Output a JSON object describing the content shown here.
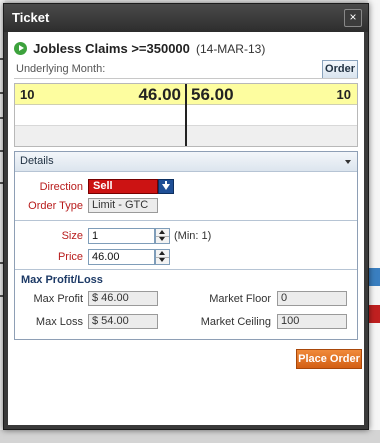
{
  "window": {
    "title": "Ticket",
    "close_glyph": "×"
  },
  "market": {
    "name": "Jobless Claims >=350000",
    "date": "(14-MAR-13)"
  },
  "underlying": {
    "label": "Underlying Month:"
  },
  "tabs": {
    "order": "Order"
  },
  "prices": {
    "bid_size": "10",
    "bid_price": "46.00",
    "ask_price": "56.00",
    "ask_size": "10"
  },
  "details": {
    "header": "Details",
    "direction_label": "Direction",
    "direction_value": "Sell",
    "order_type_label": "Order Type",
    "order_type_value": "Limit - GTC",
    "size_label": "Size",
    "size_value": "1",
    "size_min": "(Min: 1)",
    "price_label": "Price",
    "price_value": "46.00"
  },
  "profit_loss": {
    "title": "Max Profit/Loss",
    "max_profit_label": "Max Profit",
    "max_profit_value": "$ 46.00",
    "max_loss_label": "Max Loss",
    "max_loss_value": "$ 54.00",
    "market_floor_label": "Market Floor",
    "market_floor_value": "0",
    "market_ceiling_label": "Market Ceiling",
    "market_ceiling_value": "100"
  },
  "actions": {
    "place_order": "Place Order"
  },
  "colors": {
    "sell": "#cc1313",
    "accent": "#e07020",
    "bid_row": "#fdfd9f"
  }
}
